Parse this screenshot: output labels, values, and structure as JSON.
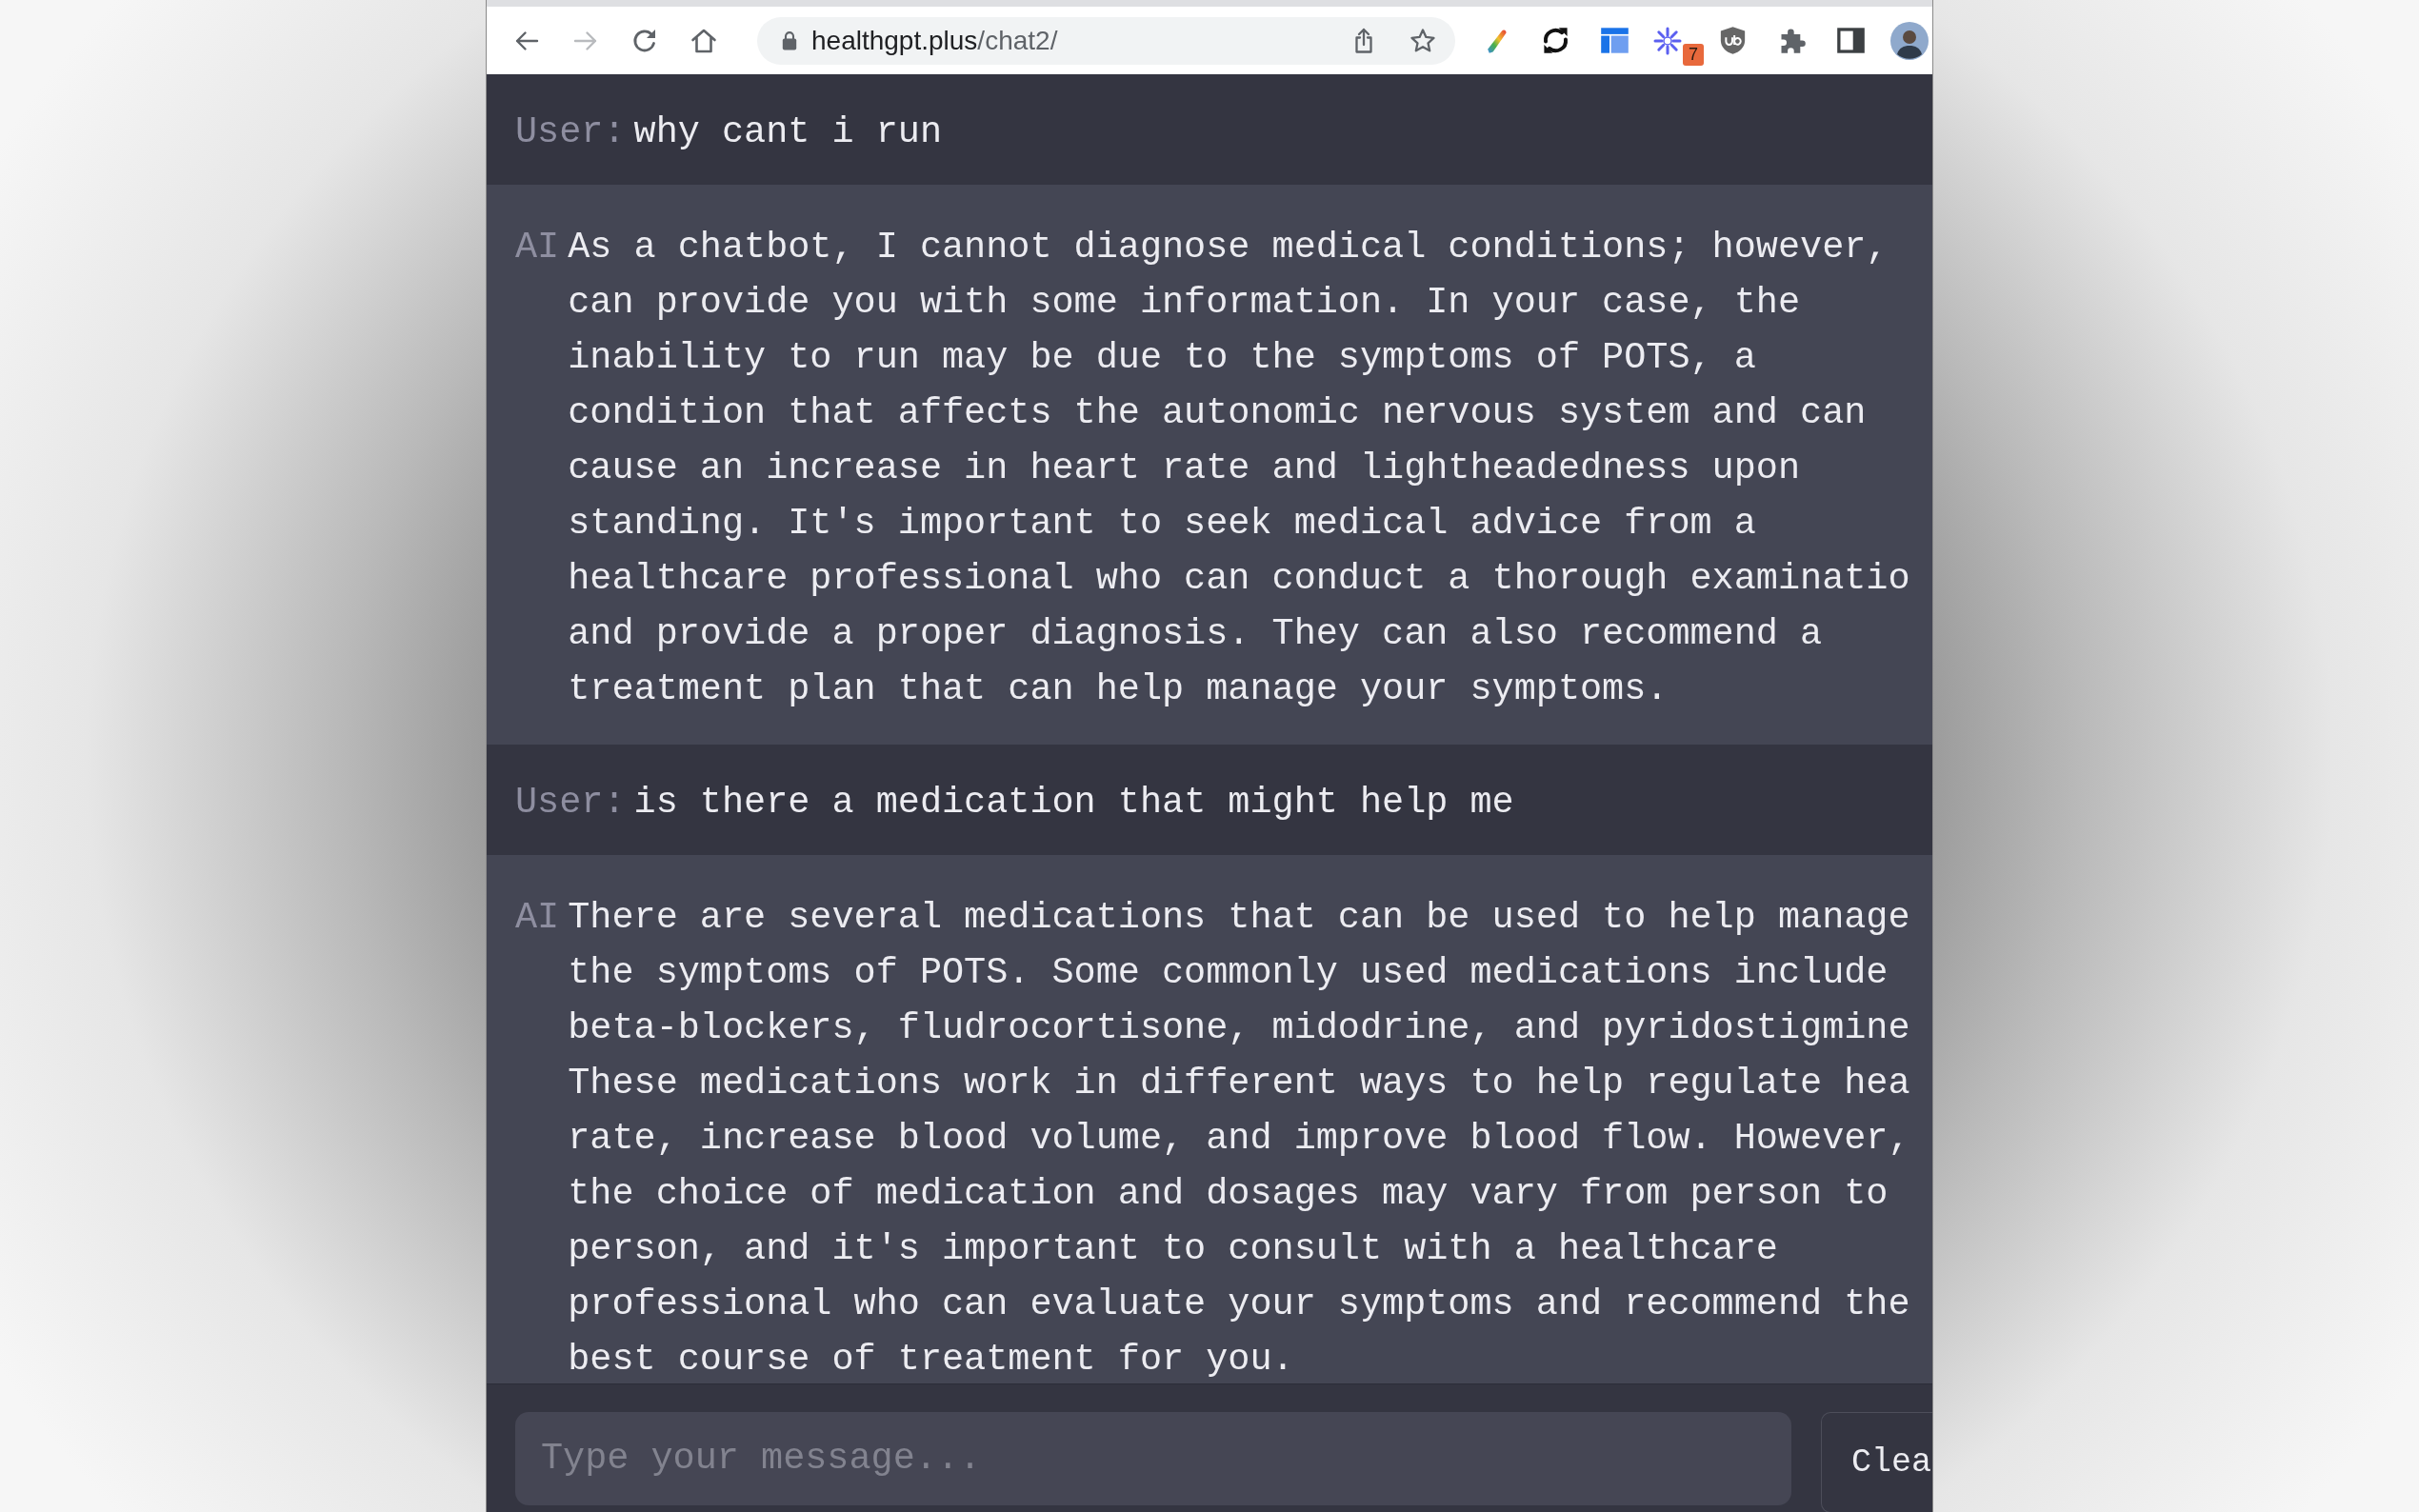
{
  "browser": {
    "nav_buttons": [
      {
        "kind": "back",
        "disabled": false
      },
      {
        "kind": "forward",
        "disabled": true
      },
      {
        "kind": "reload",
        "disabled": false
      },
      {
        "kind": "home",
        "disabled": false
      }
    ],
    "address_bar": {
      "host": "healthgpt.plus",
      "path": "/chat2/"
    },
    "page_actions": [
      {
        "kind": "share"
      },
      {
        "kind": "bookmark"
      }
    ],
    "extensions": [
      {
        "kind": "pencil"
      },
      {
        "kind": "sync"
      },
      {
        "kind": "layout"
      },
      {
        "kind": "sparkle",
        "badge": "7"
      },
      {
        "kind": "shield"
      },
      {
        "kind": "puzzle"
      },
      {
        "kind": "side-panel"
      },
      {
        "kind": "avatar"
      }
    ]
  },
  "chat": {
    "messages": [
      {
        "kind": "user",
        "speaker": "User:",
        "lines": [
          "why cant i run"
        ]
      },
      {
        "kind": "ai",
        "speaker": "AI",
        "lines": [
          "As a chatbot, I cannot diagnose medical conditions; however,",
          "can provide you with some information. In your case, the",
          "inability to run may be due to the symptoms of POTS, a",
          "condition that affects the autonomic nervous system and can",
          "cause an increase in heart rate and lightheadedness upon",
          "standing. It's important to seek medical advice from a",
          "healthcare professional who can conduct a thorough examinatio",
          "and provide a proper diagnosis. They can also recommend a",
          "treatment plan that can help manage your symptoms."
        ]
      },
      {
        "kind": "user",
        "speaker": "User:",
        "lines": [
          "is there a medication that might help me"
        ]
      },
      {
        "kind": "ai",
        "speaker": "AI",
        "lines": [
          "There are several medications that can be used to help manage",
          "the symptoms of POTS. Some commonly used medications include",
          "beta-blockers, fludrocortisone, midodrine, and pyridostigmine",
          "These medications work in different ways to help regulate hea",
          "rate, increase blood volume, and improve blood flow. However,",
          "the choice of medication and dosages may vary from person to",
          "person, and it's important to consult with a healthcare",
          "professional who can evaluate your symptoms and recommend the",
          "best course of treatment for you."
        ]
      }
    ]
  },
  "composer": {
    "placeholder": "Type your message...",
    "button": "Clea"
  }
}
